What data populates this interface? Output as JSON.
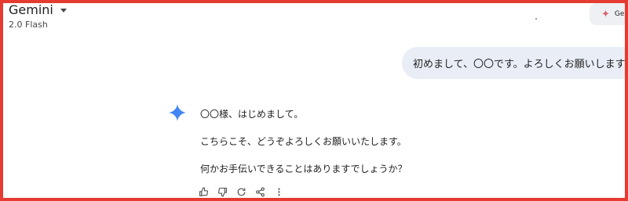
{
  "header": {
    "app_name": "Gemini",
    "model_version": "2.0 Flash",
    "corner_button_label": "Ge"
  },
  "conversation": {
    "user_message": "初めまして、〇〇です。よろしくお願いします",
    "response_paragraphs": [
      "〇〇様、はじめまして。",
      "こちらこそ、どうぞよろしくお願いいたします。",
      "何かお手伝いできることはありますでしょうか？"
    ]
  },
  "colors": {
    "frame_border": "#e53b30",
    "user_bubble_bg": "#e9eef6",
    "gemini_spark": "#4285f4",
    "corner_spark": "#d96570"
  },
  "icons": [
    "chevron-down-icon",
    "gemini-spark-icon",
    "thumbs-up-icon",
    "thumbs-down-icon",
    "redo-icon",
    "share-icon",
    "more-vert-icon"
  ]
}
